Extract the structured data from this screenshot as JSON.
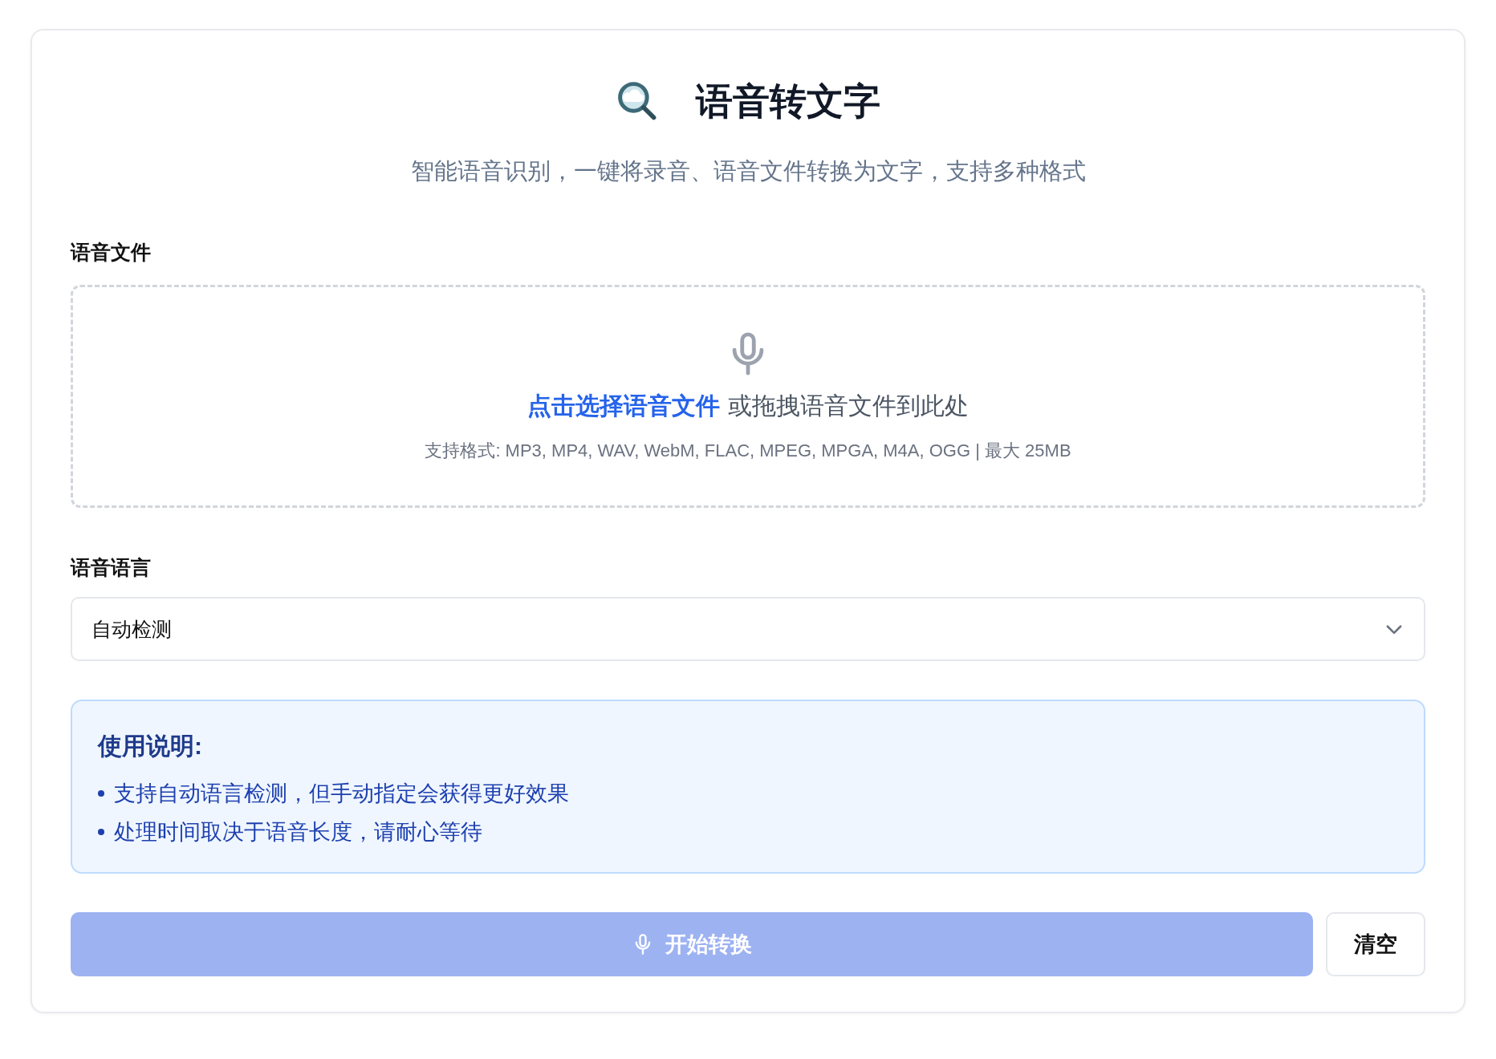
{
  "header": {
    "title": "语音转文字",
    "subtitle": "智能语音识别，一键将录音、语音文件转换为文字，支持多种格式"
  },
  "file_section": {
    "label": "语音文件",
    "dropzone": {
      "link": "点击选择语音文件",
      "text": "或拖拽语音文件到此处",
      "formats": "支持格式: MP3, MP4, WAV, WebM, FLAC, MPEG, MPGA, M4A, OGG | 最大 25MB"
    }
  },
  "language_section": {
    "label": "语音语言",
    "value": "自动检测"
  },
  "instructions": {
    "title": "使用说明:",
    "items": [
      "支持自动语言检测，但手动指定会获得更好效果",
      "处理时间取决于语音长度，请耐心等待"
    ]
  },
  "buttons": [
    {
      "label": "开始转换",
      "kind": "primary",
      "disabled": true
    },
    {
      "label": "清空",
      "kind": "secondary",
      "disabled": false
    }
  ]
}
